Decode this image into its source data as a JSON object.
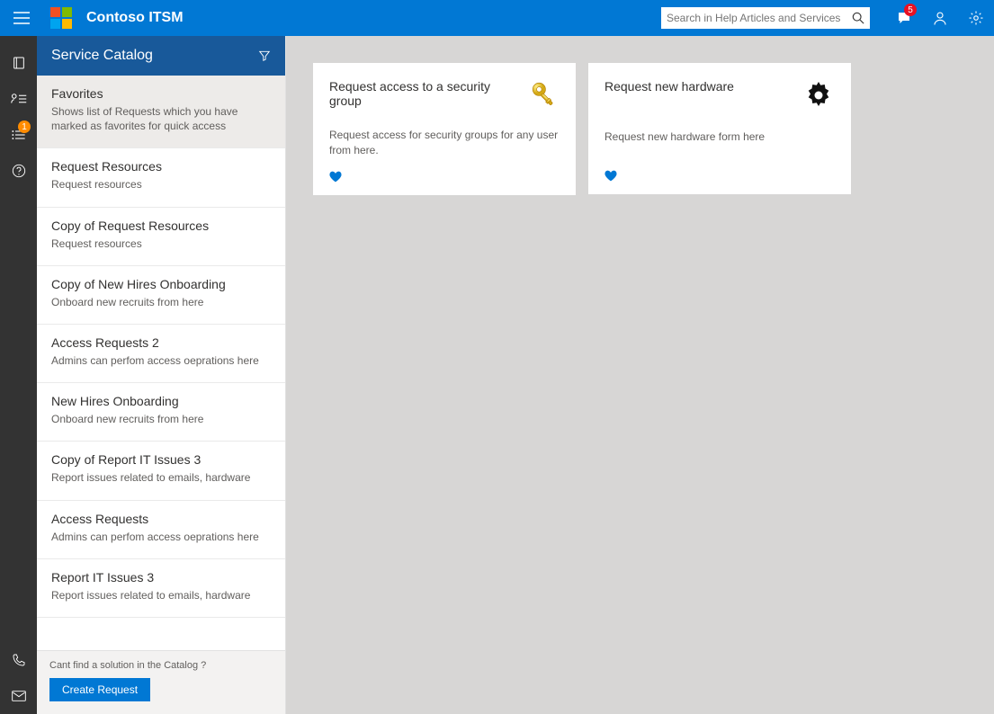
{
  "header": {
    "app_title": "Contoso ITSM",
    "search_placeholder": "Search in Help Articles and Services",
    "notification_badge": "5"
  },
  "rail_badge": "1",
  "catalog": {
    "title": "Service Catalog",
    "items": [
      {
        "title": "Favorites",
        "desc": "Shows list of Requests which you have marked as favorites for quick access",
        "selected": true
      },
      {
        "title": "Request Resources",
        "desc": "Request resources"
      },
      {
        "title": "Copy of Request Resources",
        "desc": "Request resources"
      },
      {
        "title": "Copy of New Hires Onboarding",
        "desc": "Onboard new recruits from here"
      },
      {
        "title": "Access Requests 2",
        "desc": "Admins can perfom access oeprations here"
      },
      {
        "title": "New Hires Onboarding",
        "desc": "Onboard new recruits from here"
      },
      {
        "title": "Copy of Report IT Issues 3",
        "desc": "Report issues related to emails, hardware"
      },
      {
        "title": "Access Requests",
        "desc": "Admins can perfom access oeprations here"
      },
      {
        "title": "Report IT Issues 3",
        "desc": "Report issues related to emails, hardware"
      }
    ],
    "footer_text": "Cant find a solution in the Catalog ?",
    "create_button": "Create Request"
  },
  "cards": [
    {
      "title": "Request access to a security group",
      "desc": "Request access for security groups for any user from here.",
      "icon": "key"
    },
    {
      "title": "Request new hardware",
      "desc": "Request new hardware form here",
      "icon": "gear"
    }
  ]
}
